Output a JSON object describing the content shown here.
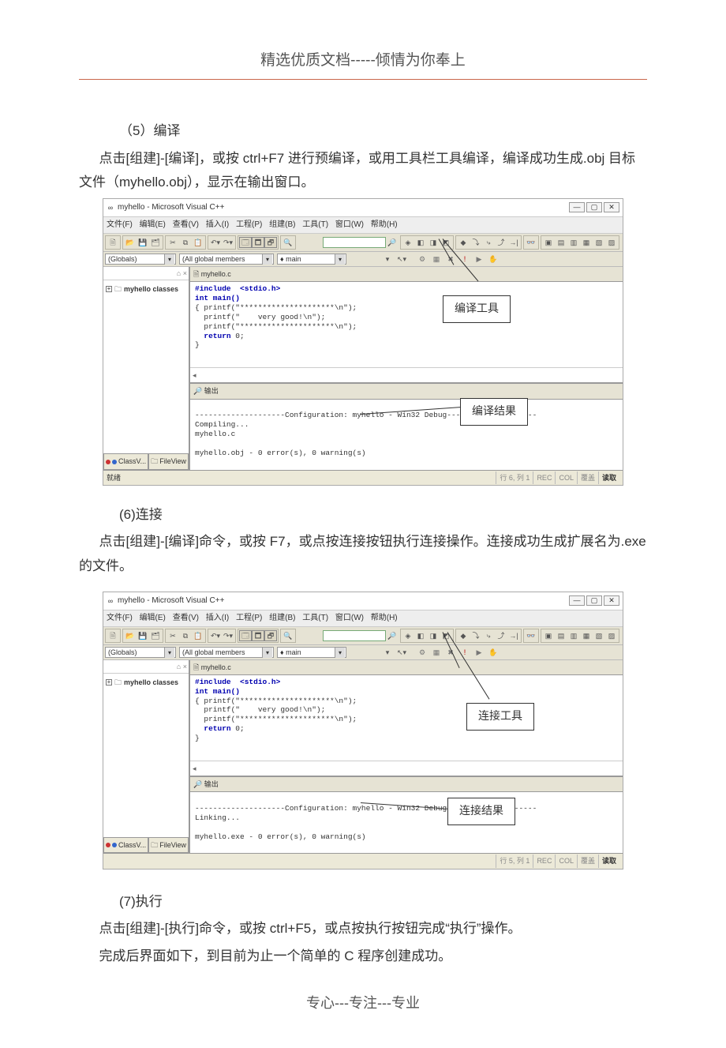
{
  "header": "精选优质文档-----倾情为你奉上",
  "footer": "专心---专注---专业",
  "section5": {
    "heading": "（5）编译",
    "body": "点击[组建]-[编译]，或按 ctrl+F7 进行预编译，或用工具栏工具编译，编译成功生成.obj 目标文件（myhello.obj），显示在输出窗口。"
  },
  "section6": {
    "heading": "(6)连接",
    "body": "点击[组建]-[编译]命令，或按 F7，或点按连接按钮执行连接操作。连接成功生成扩展名为.exe 的文件。"
  },
  "section7": {
    "heading": "(7)执行",
    "body1": "点击[组建]-[执行]命令，或按 ctrl+F5，或点按执行按钮完成“执行”操作。",
    "body2": "完成后界面如下，到目前为止一个简单的 C 程序创建成功。"
  },
  "ide": {
    "title_prefix": "myhello - Microsoft Visual C++",
    "menu": [
      "文件(F)",
      "编辑(E)",
      "查看(V)",
      "插入(I)",
      "工程(P)",
      "组建(B)",
      "工具(T)",
      "窗口(W)",
      "帮助(H)"
    ],
    "combo_globals": "(Globals)",
    "combo_members": "(All global members",
    "combo_main": "main",
    "tree_root": "myhello classes",
    "side_tab1": "ClassV...",
    "side_tab2": "FileView",
    "edit_tab": "myhello.c",
    "code_lines": [
      "#include  <stdio.h>",
      "int main()",
      "{ printf(\"*********************\\n\");",
      "  printf(\"    very good!\\n\");",
      "  printf(\"*********************\\n\");",
      "  return 0;",
      "}"
    ],
    "out_tab": "输出",
    "status_pos1": "行 6, 列 1",
    "status_pos2": "行 5, 列 1",
    "status_ready": "就绪",
    "st_rec": "REC",
    "st_col": "COL",
    "st_ovr": "覆盖",
    "st_read": "读取"
  },
  "output1": {
    "config": "--------------------Configuration: myhello - Win32 Debug--------------------",
    "l1": "Compiling...",
    "l2": "myhello.c",
    "l3": "myhello.obj - 0 error(s), 0 warning(s)"
  },
  "output2": {
    "config": "--------------------Configuration: myhello - Win32 Debug--------------------",
    "l1": "Linking...",
    "l2": "myhello.exe - 0 error(s), 0 warning(s)"
  },
  "callouts": {
    "compile_tool": "编译工具",
    "compile_result": "编译结果",
    "link_tool": "连接工具",
    "link_result": "连接结果"
  }
}
